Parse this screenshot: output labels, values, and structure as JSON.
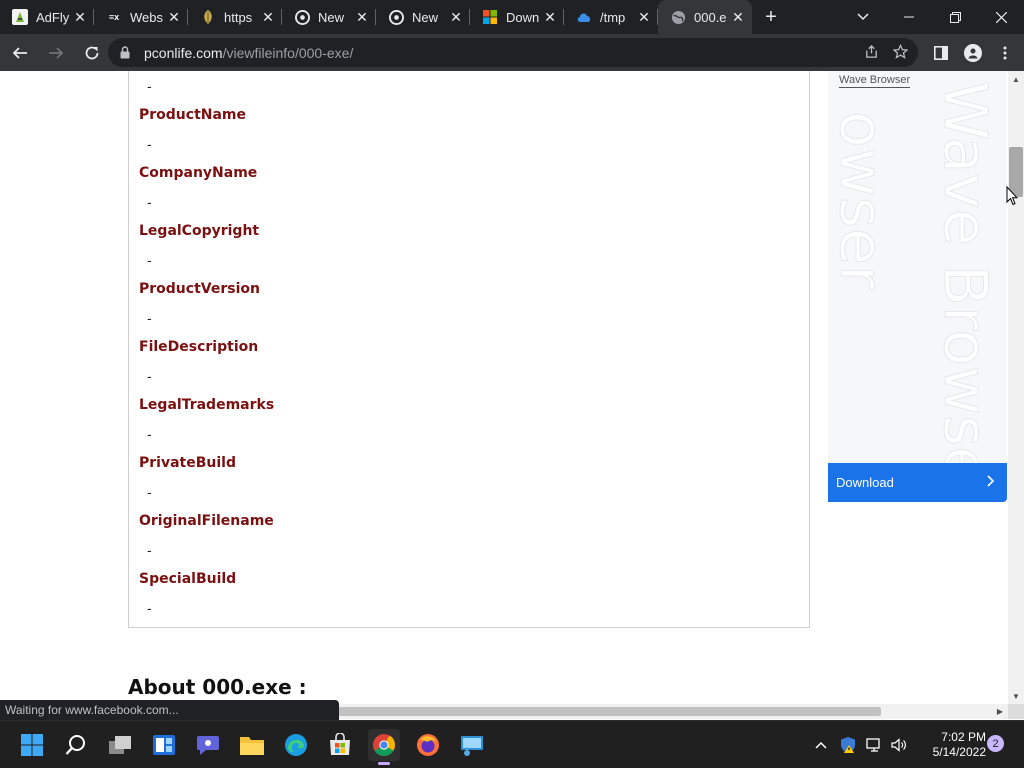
{
  "browser": {
    "tabs": [
      {
        "title": "AdFly",
        "favicon": "adfly-icon"
      },
      {
        "title": "Webs",
        "favicon": "ex-site-icon"
      },
      {
        "title": "https",
        "favicon": "leaf-icon"
      },
      {
        "title": "New",
        "favicon": "chrome-icon"
      },
      {
        "title": "New",
        "favicon": "chrome-icon"
      },
      {
        "title": "Down",
        "favicon": "microsoft-icon"
      },
      {
        "title": "/tmp",
        "favicon": "cloud-icon"
      },
      {
        "title": "000.e",
        "favicon": "globe-icon",
        "active": true
      }
    ],
    "new_tab_symbol": "+",
    "url_host": "pconlife.com",
    "url_path": "/viewfileinfo/000-exe/",
    "status_text": "Waiting for www.facebook.com..."
  },
  "page": {
    "fields": [
      {
        "name": "ProductName",
        "value": "-"
      },
      {
        "name": "CompanyName",
        "value": "-"
      },
      {
        "name": "LegalCopyright",
        "value": "-"
      },
      {
        "name": "ProductVersion",
        "value": "-"
      },
      {
        "name": "FileDescription",
        "value": "-"
      },
      {
        "name": "LegalTrademarks",
        "value": "-"
      },
      {
        "name": "PrivateBuild",
        "value": "-"
      },
      {
        "name": "OriginalFilename",
        "value": "-"
      },
      {
        "name": "SpecialBuild",
        "value": "-"
      }
    ],
    "top_value": "-",
    "about_heading": "About 000.exe :"
  },
  "ad": {
    "brand": "Wave Browser",
    "watermark_1": "Wave Browser",
    "watermark_2": "owser",
    "button_label": "Download",
    "button_color": "#1a73e8"
  },
  "taskbar": {
    "time": "7:02 PM",
    "date": "5/14/2022",
    "notification_count": "2",
    "accent": "#c8a8ff"
  },
  "colors": {
    "field_label": "#7a1010",
    "tab_strip": "#202124",
    "toolbar": "#35363a"
  }
}
